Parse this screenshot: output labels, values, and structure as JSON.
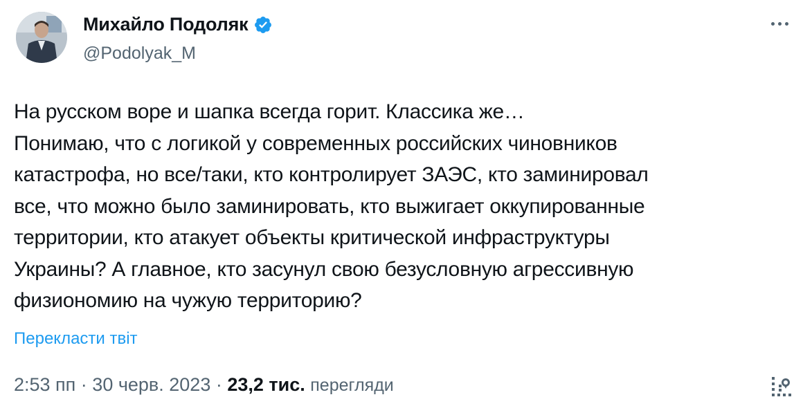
{
  "author": {
    "name": "Михайло Подоляк",
    "handle": "@Podolyak_M",
    "verified_color": "#1d9bf0"
  },
  "tweet": {
    "lines": [
      "На русском воре и шапка всегда горит. Классика же…",
      "Понимаю, что с логикой у современных российских чиновников",
      "катастрофа, но все/таки, кто контролирует ЗАЭС, кто заминировал",
      "все, что можно было заминировать, кто выжигает оккупированные",
      "территории, кто атакует объекты критической инфраструктуры",
      "Украины? А главное, кто засунул свою безусловную агрессивную",
      "физиономию на чужую территорию?"
    ],
    "translate_label": "Перекласти твіт"
  },
  "meta": {
    "time": "2:53 пп",
    "sep1": " · ",
    "date": "30 черв. 2023",
    "sep2": " · ",
    "views_count": "23,2 тис.",
    "views_label": "перегляди"
  },
  "icons": {
    "verified": "verified-badge-icon",
    "more": "more-options-icon",
    "analytics": "analytics-icon"
  },
  "colors": {
    "link": "#1d9bf0",
    "secondary": "#536471",
    "primary": "#0f1419"
  }
}
